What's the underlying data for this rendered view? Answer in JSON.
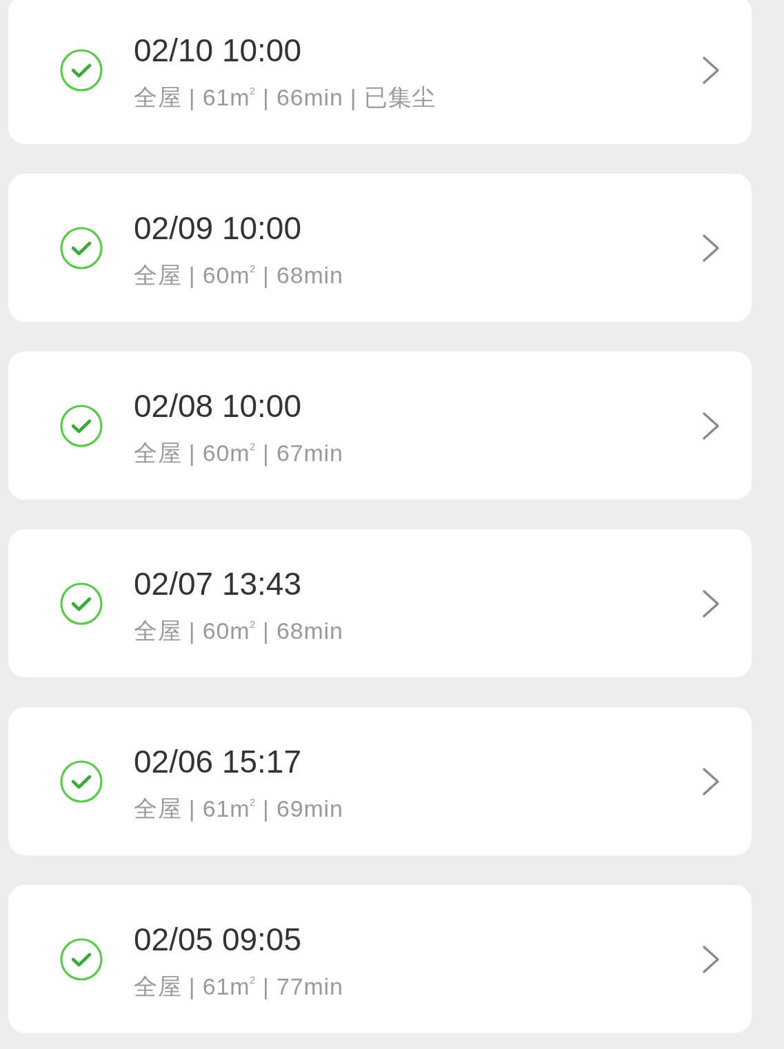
{
  "records": [
    {
      "time": "02/10 10:00",
      "summary": "全屋 | 61m$^{2}$ | 66min | 已集尘",
      "completed": true
    },
    {
      "time": "02/09 10:00",
      "summary": "全屋 | 60m$^{2}$ | 68min",
      "completed": true
    },
    {
      "time": "02/08 10:00",
      "summary": "全屋 | 60m$^{2}$ | 67min",
      "completed": true
    },
    {
      "time": "02/07 13:43",
      "summary": "全屋 | 60m$^{2}$ | 68min",
      "completed": true
    },
    {
      "time": "02/06 15:17",
      "summary": "全屋 | 61m$^{2}$ | 69min",
      "completed": true
    },
    {
      "time": "02/05 09:05",
      "summary": "全屋 | 61m$^{2}$ | 77min",
      "completed": true
    }
  ]
}
